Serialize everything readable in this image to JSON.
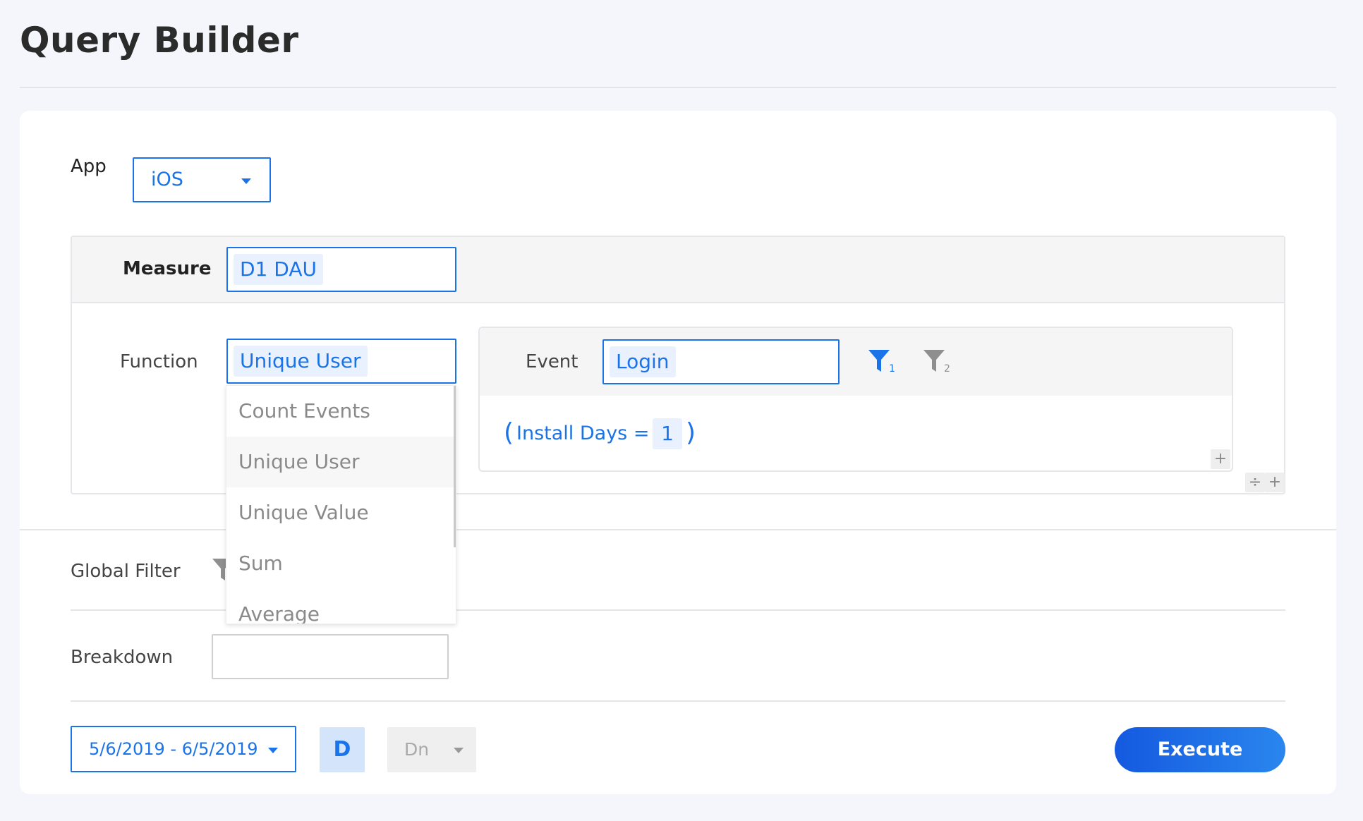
{
  "page": {
    "title": "Query Builder"
  },
  "app": {
    "label": "App",
    "selected": "iOS"
  },
  "measure": {
    "label": "Measure",
    "value": "D1 DAU"
  },
  "function": {
    "label": "Function",
    "selected": "Unique User",
    "options": [
      "Count Events",
      "Unique User",
      "Unique Value",
      "Sum",
      "Average"
    ]
  },
  "event": {
    "label": "Event",
    "value": "Login",
    "filter1_sub": "1",
    "filter2_sub": "2",
    "condition": {
      "open_paren": "(",
      "field": "Install Days =",
      "value": "1",
      "close_paren": ")"
    }
  },
  "global_filter": {
    "label": "Global Filter"
  },
  "breakdown": {
    "label": "Breakdown",
    "value": ""
  },
  "footer": {
    "date_range": "5/6/2019 - 6/5/2019",
    "granularity": "D",
    "dn_label": "Dn",
    "execute_label": "Execute"
  },
  "icons": {
    "plus": "+",
    "split": "÷"
  },
  "colors": {
    "accent": "#1a73e8",
    "execute_gradient_start": "#1459e0",
    "execute_gradient_end": "#2a86ee"
  }
}
